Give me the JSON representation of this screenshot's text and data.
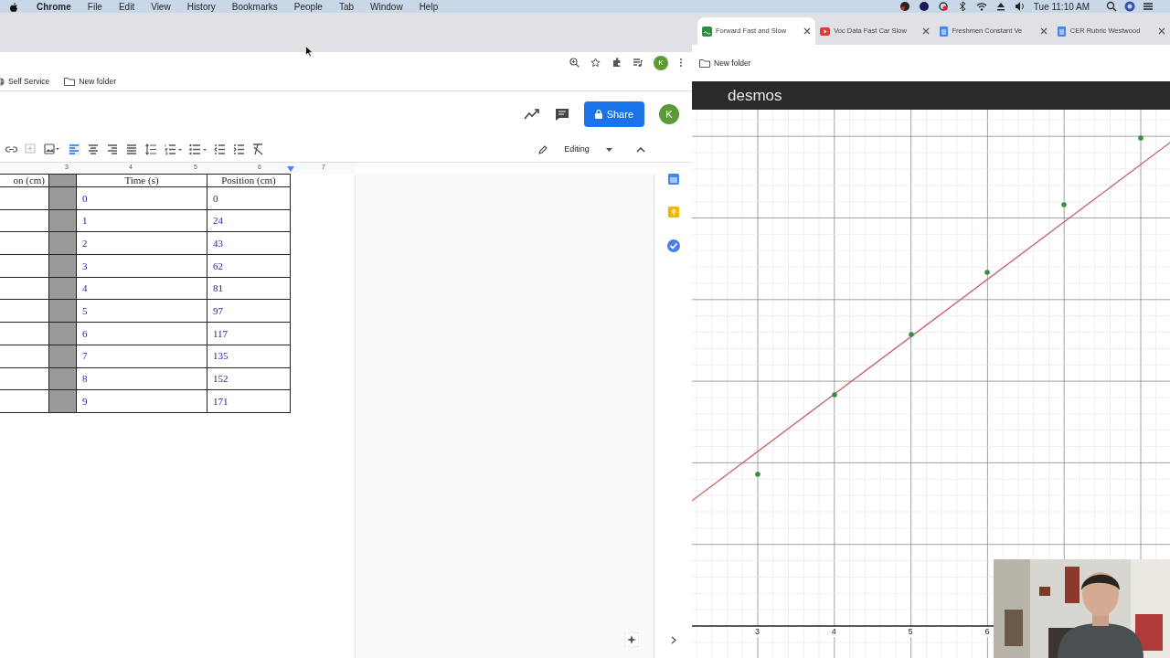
{
  "menu_bar": {
    "app": "Chrome",
    "items": [
      "File",
      "Edit",
      "View",
      "History",
      "Bookmarks",
      "People",
      "Tab",
      "Window",
      "Help"
    ],
    "clock": "Tue 11:10 AM"
  },
  "docs_window": {
    "bookmarks": [
      "Self Service",
      "New folder"
    ],
    "share_label": "Share",
    "avatar": "K",
    "browser_avatar": "K",
    "mode": "Editing",
    "ruler": [
      "3",
      "4",
      "5",
      "6",
      "7"
    ],
    "table": {
      "columns": [
        "on (cm)",
        "Time (s)",
        "Position (cm)"
      ],
      "rows": [
        [
          "",
          "0",
          "0"
        ],
        [
          "",
          "1",
          "24"
        ],
        [
          "",
          "2",
          "43"
        ],
        [
          "",
          "3",
          "62"
        ],
        [
          "",
          "4",
          "81"
        ],
        [
          "",
          "5",
          "97"
        ],
        [
          "",
          "6",
          "117"
        ],
        [
          "",
          "7",
          "135"
        ],
        [
          "",
          "8",
          "152"
        ],
        [
          "",
          "9",
          "171"
        ]
      ]
    }
  },
  "graph_window": {
    "tabs": [
      {
        "title": "Forward Fast and Slow",
        "kind": "desmos",
        "selected": true
      },
      {
        "title": "Voc Data Fast Car Slow",
        "kind": "video",
        "selected": false
      },
      {
        "title": "Freshmen Constant Ve",
        "kind": "doc",
        "selected": false
      },
      {
        "title": "CER Rubric Westwood",
        "kind": "doc",
        "selected": false
      }
    ],
    "bookmark": "New folder",
    "logo": "desmos",
    "x_labels": [
      "3",
      "4",
      "5",
      "6"
    ],
    "webcam": {
      "kind": "picture"
    }
  }
}
